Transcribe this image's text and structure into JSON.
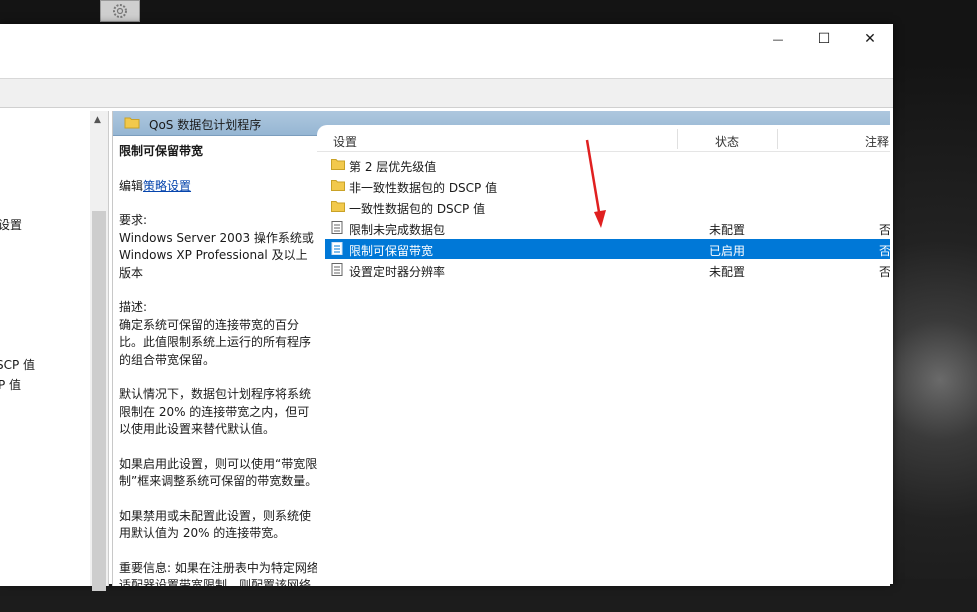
{
  "window": {
    "controls": {
      "minimize": "—",
      "maximize": "☐",
      "close": "✕"
    }
  },
  "tree": {
    "items": [
      {
        "label": "设置"
      },
      {
        "label": "SCP 值"
      },
      {
        "label": "P 值"
      }
    ]
  },
  "pane": {
    "header_title": "QoS 数据包计划程序"
  },
  "description": {
    "title": "限制可保留带宽",
    "edit_prefix": "编辑",
    "edit_link": "策略设置",
    "requirements_label": "要求:",
    "requirements_text": "Windows Server 2003 操作系统或 Windows XP Professional 及以上版本",
    "description_label": "描述:",
    "description_text": "确定系统可保留的连接带宽的百分比。此值限制系统上运行的所有程序的组合带宽保留。",
    "default_text": "默认情况下，数据包计划程序将系统限制在 20% 的连接带宽之内，但可以使用此设置来替代默认值。",
    "enabled_text": "如果启用此设置，则可以使用“带宽限制”框来调整系统可保留的带宽数量。",
    "disabled_text": "如果禁用或未配置此设置，则系统使用默认值为 20% 的连接带宽。",
    "important_text": "重要信息: 如果在注册表中为特定网络适配器设置带宽限制，则配置该网络"
  },
  "list": {
    "columns": {
      "setting": "设置",
      "status": "状态",
      "note": "注释"
    },
    "rows": [
      {
        "type": "folder",
        "label": "第 2 层优先级值",
        "status": "",
        "note": ""
      },
      {
        "type": "folder",
        "label": "非一致性数据包的 DSCP 值",
        "status": "",
        "note": ""
      },
      {
        "type": "folder",
        "label": "一致性数据包的 DSCP 值",
        "status": "",
        "note": ""
      },
      {
        "type": "policy",
        "label": "限制未完成数据包",
        "status": "未配置",
        "note": "否"
      },
      {
        "type": "policy",
        "label": "限制可保留带宽",
        "status": "已启用",
        "note": "否",
        "selected": true
      },
      {
        "type": "policy",
        "label": "设置定时器分辨率",
        "status": "未配置",
        "note": "否"
      }
    ]
  },
  "colors": {
    "selection": "#0078d7",
    "header_band": "#a6c1da",
    "annotation_arrow": "#e02020"
  }
}
